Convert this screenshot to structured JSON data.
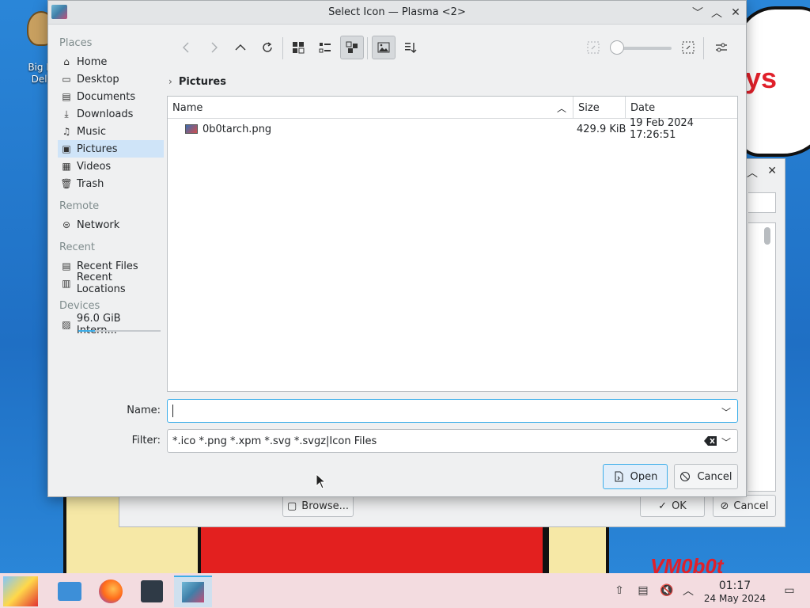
{
  "window": {
    "title": "Select Icon — Plasma <2>"
  },
  "desktop": {
    "icon_label": "Big M\nDelt",
    "wallpaper_text": "ys",
    "watermark": "VM0b0t"
  },
  "sidebar": {
    "sections": [
      {
        "label": "Places",
        "items": [
          {
            "label": "Home",
            "icon": "home-icon"
          },
          {
            "label": "Desktop",
            "icon": "desktop-icon"
          },
          {
            "label": "Documents",
            "icon": "documents-icon"
          },
          {
            "label": "Downloads",
            "icon": "downloads-icon"
          },
          {
            "label": "Music",
            "icon": "music-icon"
          },
          {
            "label": "Pictures",
            "icon": "pictures-icon",
            "selected": true
          },
          {
            "label": "Videos",
            "icon": "videos-icon"
          },
          {
            "label": "Trash",
            "icon": "trash-icon"
          }
        ]
      },
      {
        "label": "Remote",
        "items": [
          {
            "label": "Network",
            "icon": "network-icon"
          }
        ]
      },
      {
        "label": "Recent",
        "items": [
          {
            "label": "Recent Files",
            "icon": "recent-files-icon"
          },
          {
            "label": "Recent Locations",
            "icon": "recent-locations-icon"
          }
        ]
      },
      {
        "label": "Devices",
        "items": [
          {
            "label": "96.0 GiB Intern...",
            "icon": "drive-icon",
            "usage": 0.2
          }
        ]
      }
    ]
  },
  "breadcrumb": {
    "current": "Pictures"
  },
  "file_list": {
    "columns": [
      "Name",
      "Size",
      "Date"
    ],
    "rows": [
      {
        "name": "0b0tarch.png",
        "size": "429.9 KiB",
        "date": "19 Feb 2024 17:26:51"
      }
    ]
  },
  "form": {
    "name_label": "Name:",
    "name_value": "",
    "filter_label": "Filter:",
    "filter_value": "*.ico *.png *.xpm *.svg *.svgz|Icon Files"
  },
  "buttons": {
    "open": "Open",
    "cancel": "Cancel"
  },
  "background_dialog": {
    "browse": "Browse...",
    "ok": "OK",
    "cancel": "Cancel"
  },
  "taskbar": {
    "time": "01:17",
    "date": "24 May 2024"
  },
  "colors": {
    "accent": "#3daee9",
    "selection": "#cfe4f8",
    "taskbar": "#f3dce0"
  }
}
